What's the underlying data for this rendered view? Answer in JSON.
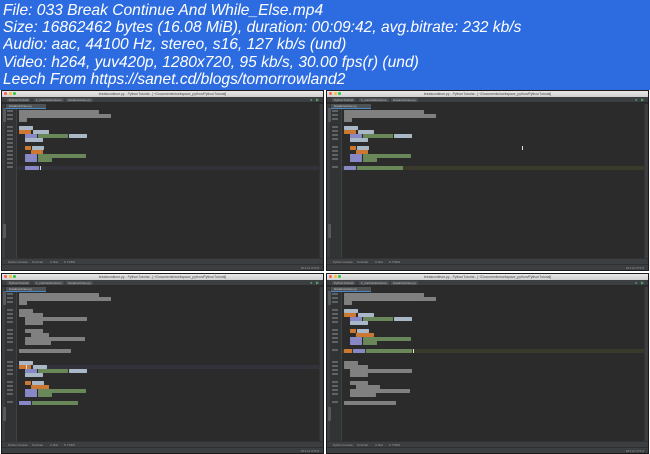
{
  "header": {
    "lines": [
      "File: 033 Break Continue And While_Else.mp4",
      "Size: 16862462 bytes (16.08 MiB), duration: 00:09:42, avg.bitrate: 232 kb/s",
      "Audio: aac, 44100 Hz, stereo, s16, 127 kb/s (und)",
      "Video: h264, yuv420p, 1280x720, 95 kb/s, 30.00 fps(r) (und)",
      "Leech From https://sanet.cd/blogs/tomorrowland2"
    ]
  },
  "ide": {
    "window_title": "breakcontinue.py - PythonTutorial - [~/Documents/workspace_python/PythonTutorial]",
    "breadcrumbs": [
      "PythonTutorial",
      "1_controlstructures",
      "breakcontinue.py"
    ],
    "file_tab": "breakcontinue.py",
    "tool_windows": [
      "Python Console",
      "Terminal",
      "4: Run",
      "6: TODO"
    ],
    "status_right": "18:4  LF  UTF-8",
    "run_icon": "play-icon",
    "debug_icon": "bug-icon"
  },
  "colors": {
    "header_bg": "#2d6ce0",
    "editor_bg": "#2b2b2b",
    "keyword": "#cc7832",
    "string": "#6a8759",
    "number": "#6897bb",
    "comment": "#808080"
  }
}
